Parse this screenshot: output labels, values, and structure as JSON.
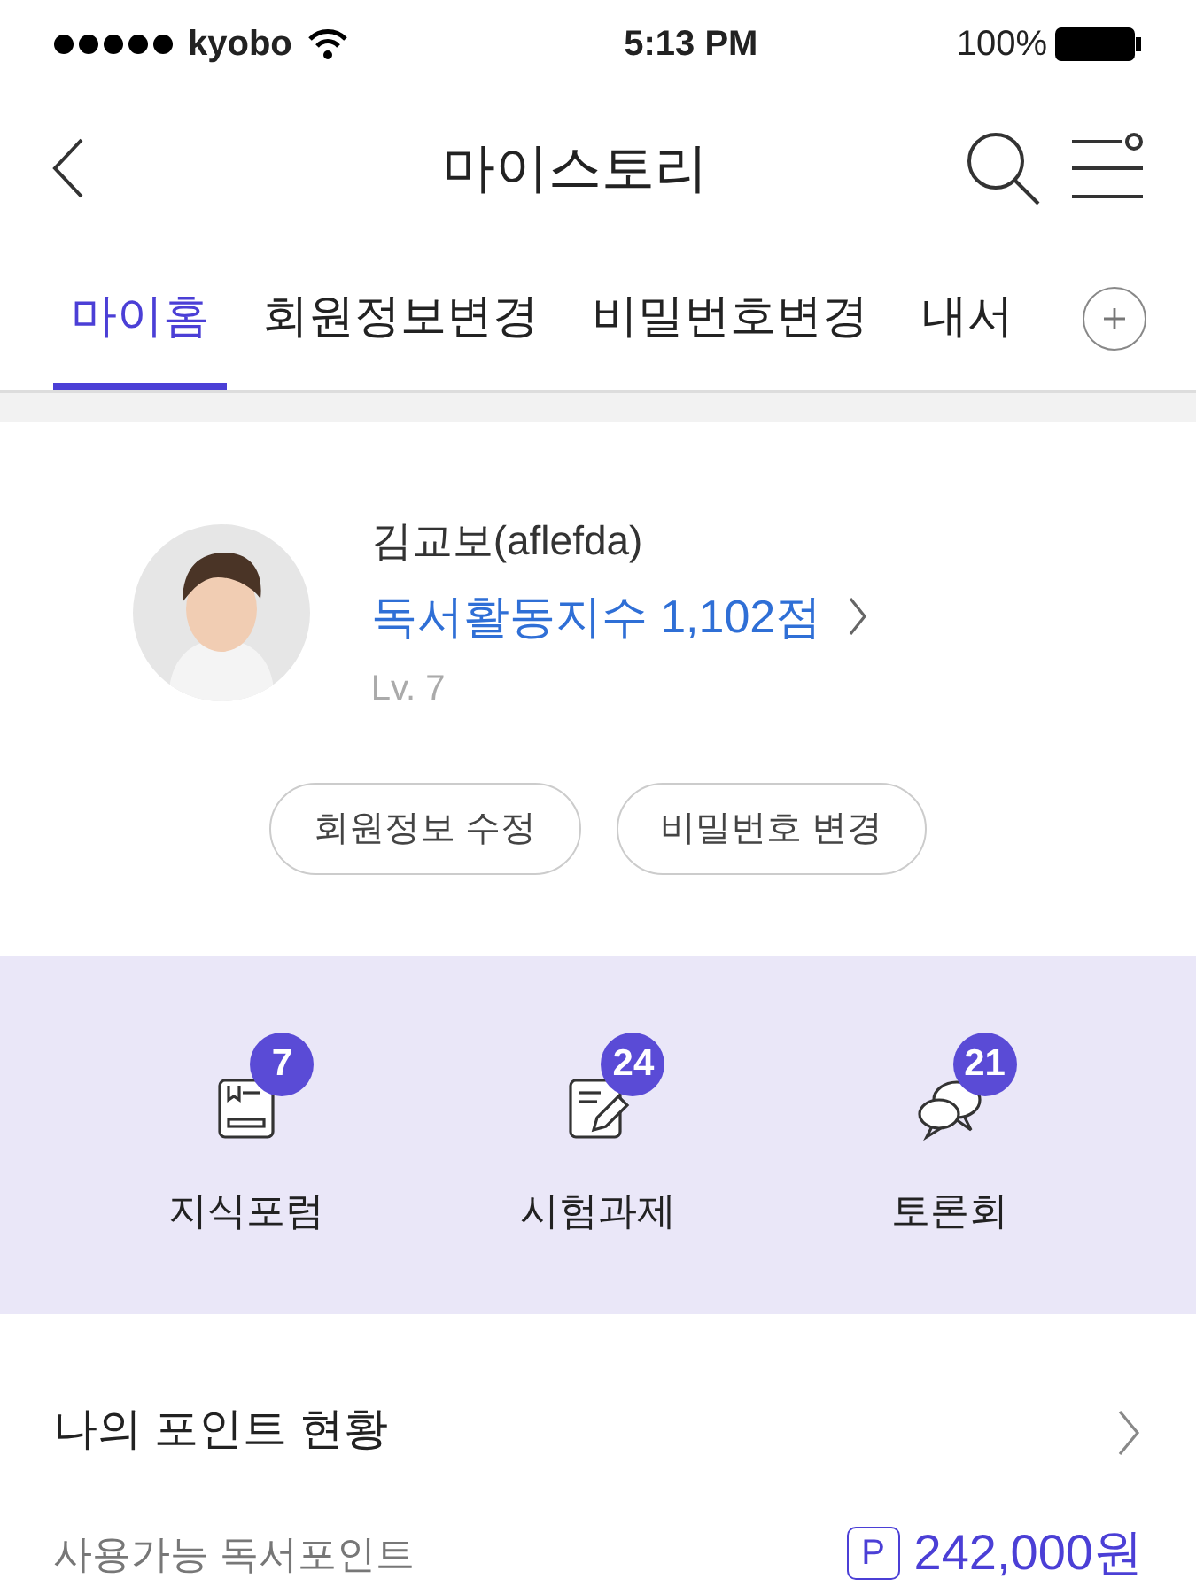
{
  "status_bar": {
    "carrier": "kyobo",
    "time": "5:13 PM",
    "battery": "100%"
  },
  "header": {
    "title": "마이스토리"
  },
  "tabs": [
    {
      "label": "마이홈",
      "selected": true
    },
    {
      "label": "회원정보변경",
      "selected": false
    },
    {
      "label": "비밀번호변경",
      "selected": false
    },
    {
      "label": "내서",
      "selected": false
    }
  ],
  "profile": {
    "name": "김교보(aflefda)",
    "reading_index": "독서활동지수 1,102점",
    "level": "Lv. 7",
    "buttons": [
      "회원정보 수정",
      "비밀번호 변경"
    ]
  },
  "activities": [
    {
      "kind": "forum",
      "label": "지식포럼",
      "count": "7"
    },
    {
      "kind": "assignment",
      "label": "시험과제",
      "count": "24"
    },
    {
      "kind": "debate",
      "label": "토론회",
      "count": "21"
    }
  ],
  "points": {
    "title": "나의 포인트 현황",
    "label": "사용가능 독서포인트",
    "symbol": "P",
    "amount": "242,000원"
  }
}
